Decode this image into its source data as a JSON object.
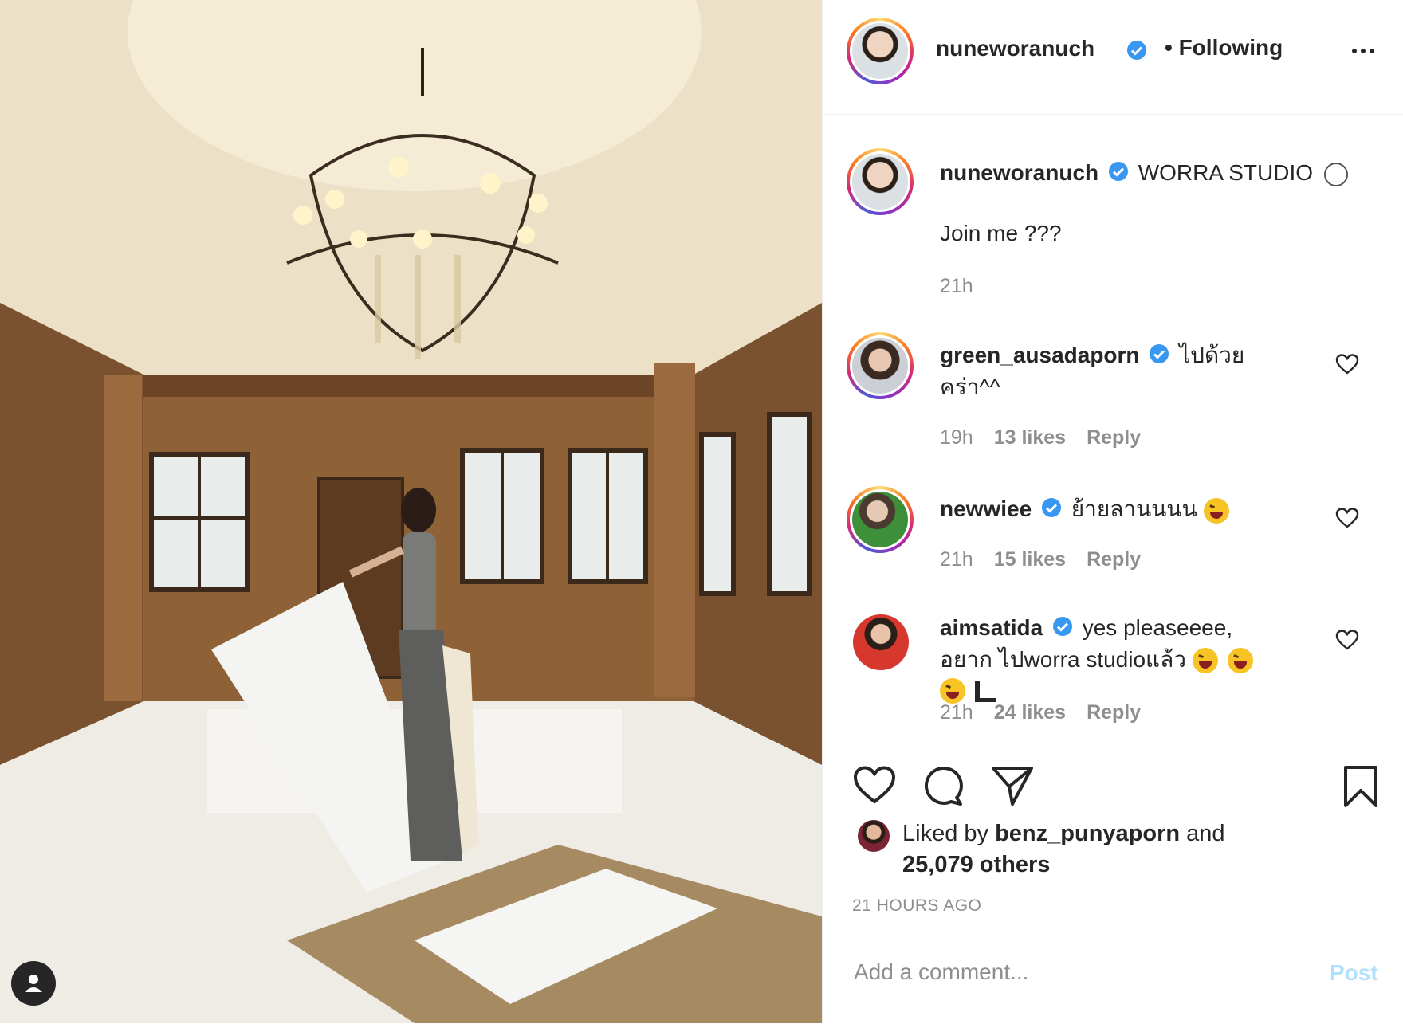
{
  "post": {
    "author": "nuneworanuch",
    "follow_status": "• Following",
    "caption_location": "WORRA STUDIO",
    "caption_text": "Join me ???",
    "caption_time": "21h"
  },
  "comments": [
    {
      "user": "green_ausadaporn",
      "text": "ไปด้วย คร่า^^",
      "time": "19h",
      "likes": "13 likes",
      "reply": "Reply"
    },
    {
      "user": "newwiee",
      "text": "ย้ายลานนนน",
      "time": "21h",
      "likes": "15 likes",
      "reply": "Reply"
    },
    {
      "user": "aimsatida",
      "text": "yes pleaseeee, อยาก ไปworra studioแล้ว",
      "time": "21h",
      "likes": "24 likes",
      "reply": "Reply"
    }
  ],
  "likes": {
    "prefix": "Liked by",
    "user": "benz_punyaporn",
    "and": "and",
    "others": "25,079 others"
  },
  "time_ago": "21 HOURS AGO",
  "add_comment": {
    "placeholder": "Add a comment...",
    "post_label": "Post"
  },
  "colors": {
    "verified": "#3897f0",
    "post_disabled": "#b2dffc",
    "meta_gray": "#8e8e8e"
  },
  "icons": [
    "user-tag-icon",
    "verified-icon",
    "more-icon",
    "heart-icon",
    "comment-icon",
    "share-icon",
    "bookmark-icon"
  ]
}
